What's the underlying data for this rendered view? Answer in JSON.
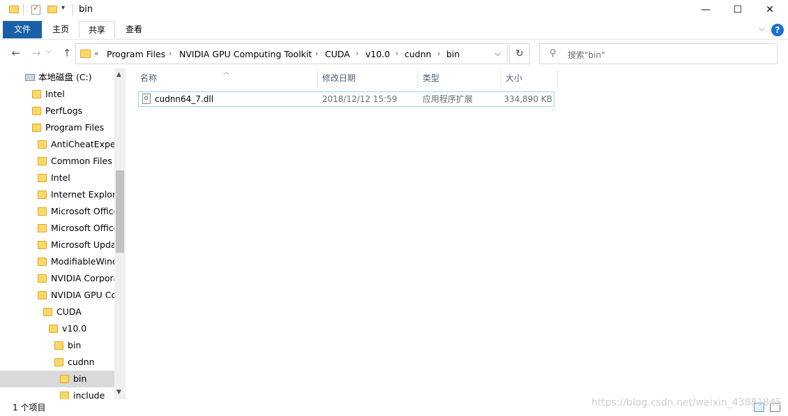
{
  "window": {
    "title": "bin"
  },
  "window_controls": {
    "minimize": "—",
    "maximize": "☐",
    "close": "✕"
  },
  "ribbon": {
    "tabs": [
      {
        "label": "文件"
      },
      {
        "label": "主页"
      },
      {
        "label": "共享"
      },
      {
        "label": "查看"
      }
    ],
    "help": "?"
  },
  "nav": {
    "back": "←",
    "forward": "→",
    "up": "↑",
    "overflow": "«",
    "breadcrumbs": [
      "Program Files",
      "NVIDIA GPU Computing Toolkit",
      "CUDA",
      "v10.0",
      "cudnn",
      "bin"
    ],
    "dropdown": "⌵",
    "refresh": "↻"
  },
  "search": {
    "placeholder": "搜索\"bin\""
  },
  "tree": [
    {
      "label": "本地磁盘 (C:)",
      "icon": "drive-icon"
    },
    {
      "label": "Intel"
    },
    {
      "label": "PerfLogs"
    },
    {
      "label": "Program Files"
    },
    {
      "label": "AntiCheatExpert"
    },
    {
      "label": "Common Files"
    },
    {
      "label": "Intel"
    },
    {
      "label": "Internet Explorer"
    },
    {
      "label": "Microsoft Office"
    },
    {
      "label": "Microsoft Office"
    },
    {
      "label": "Microsoft Update"
    },
    {
      "label": "ModifiableWindows"
    },
    {
      "label": "NVIDIA Corporation"
    },
    {
      "label": "NVIDIA GPU Computing"
    },
    {
      "label": "CUDA"
    },
    {
      "label": "v10.0"
    },
    {
      "label": "bin"
    },
    {
      "label": "cudnn"
    },
    {
      "label": "bin",
      "selected": true
    },
    {
      "label": "include"
    }
  ],
  "columns": {
    "name": "名称",
    "date": "修改日期",
    "type": "类型",
    "size": "大小"
  },
  "files": [
    {
      "name": "cudnn64_7.dll",
      "date": "2018/12/12 15:59",
      "type": "应用程序扩展",
      "size": "334,890 KB"
    }
  ],
  "status": {
    "count": "1 个项目"
  },
  "watermark": "https://blog.csdn.net/weixin_43881845",
  "colors": {
    "file_tab": "#1a5fa8",
    "folder": "#ffd766",
    "selection_border": "#99d1ff",
    "help": "#1a6fd6"
  }
}
